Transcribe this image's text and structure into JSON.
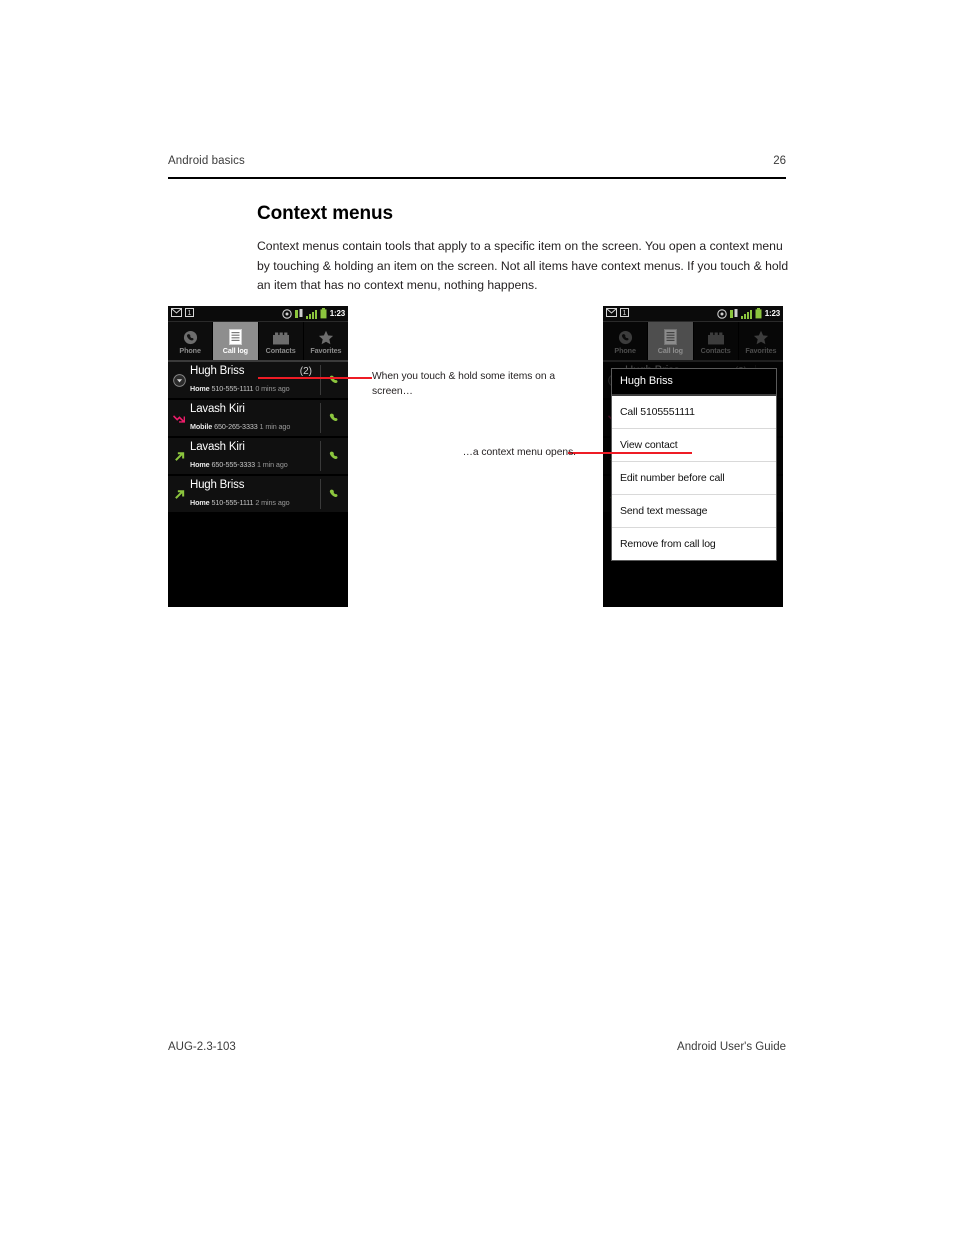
{
  "header": {
    "left": "Android basics",
    "page_number": "26"
  },
  "section": {
    "title": "Context menus",
    "body": "Context menus contain tools that apply to a specific item on the screen. You open a context menu by touching & holding an item on the screen. Not all items have context menus. If you touch & hold an item that has no context menu, nothing happens."
  },
  "footer": {
    "left": "AUG-2.3-103",
    "right": "Android User's Guide"
  },
  "annotations": [
    {
      "id": "touch-hold",
      "text": "When you touch & hold some items on a screen…"
    },
    {
      "id": "context-opens",
      "text": "…a context menu opens."
    }
  ],
  "statusbar": {
    "clock": "1:23",
    "left_icons": [
      "envelope-icon",
      "sim-card-icon"
    ],
    "right_icons": [
      "gps-icon",
      "sync-icon",
      "signal-bars-icon",
      "battery-icon"
    ]
  },
  "tabs": [
    {
      "label": "Phone",
      "icon": "phone-handset-icon",
      "selected": false
    },
    {
      "label": "Call log",
      "icon": "call-log-list-icon",
      "selected": true
    },
    {
      "label": "Contacts",
      "icon": "contacts-book-icon",
      "selected": false
    },
    {
      "label": "Favorites",
      "icon": "star-icon",
      "selected": false
    }
  ],
  "call_log": [
    {
      "direction": "missed-expand-icon",
      "name": "Hugh Briss",
      "count": "(2)",
      "label": "Home",
      "number": "510-555-1111",
      "ago": "0 mins ago"
    },
    {
      "direction": "missed-call-icon",
      "name": "Lavash Kiri",
      "count": "",
      "label": "Mobile",
      "number": "650-265-3333",
      "ago": "1 min ago"
    },
    {
      "direction": "outgoing-call-icon",
      "name": "Lavash Kiri",
      "count": "",
      "label": "Home",
      "number": "650-555-3333",
      "ago": "1 min ago"
    },
    {
      "direction": "outgoing-call-icon",
      "name": "Hugh Briss",
      "count": "",
      "label": "Home",
      "number": "510-555-1111",
      "ago": "2 mins ago"
    }
  ],
  "context_menu": {
    "title": "Hugh Briss",
    "items": [
      "Call 5105551111",
      "View contact",
      "Edit number before call",
      "Send text message",
      "Remove from call log"
    ]
  },
  "colors": {
    "annotation_red": "#ee1c25",
    "android_green": "#8cc63e",
    "missed_red": "#ee1c6a",
    "tab_selected_bg": "#8e8e8e"
  }
}
